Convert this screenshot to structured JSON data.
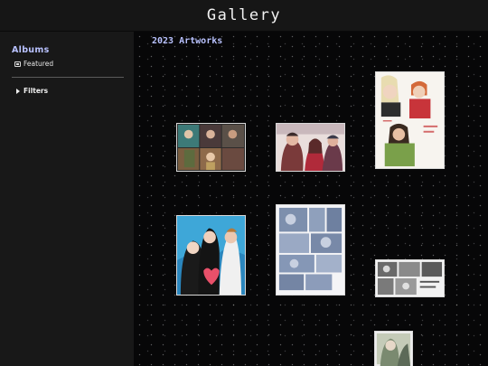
{
  "header": {
    "title": "Gallery"
  },
  "sidebar": {
    "albums_heading": "Albums",
    "featured_label": "Featured",
    "filters_label": "Filters"
  },
  "main": {
    "section_title": "2023 Artworks"
  },
  "colors": {
    "accent": "#b9c2ff",
    "background": "#111111",
    "canvas": "#070708"
  }
}
